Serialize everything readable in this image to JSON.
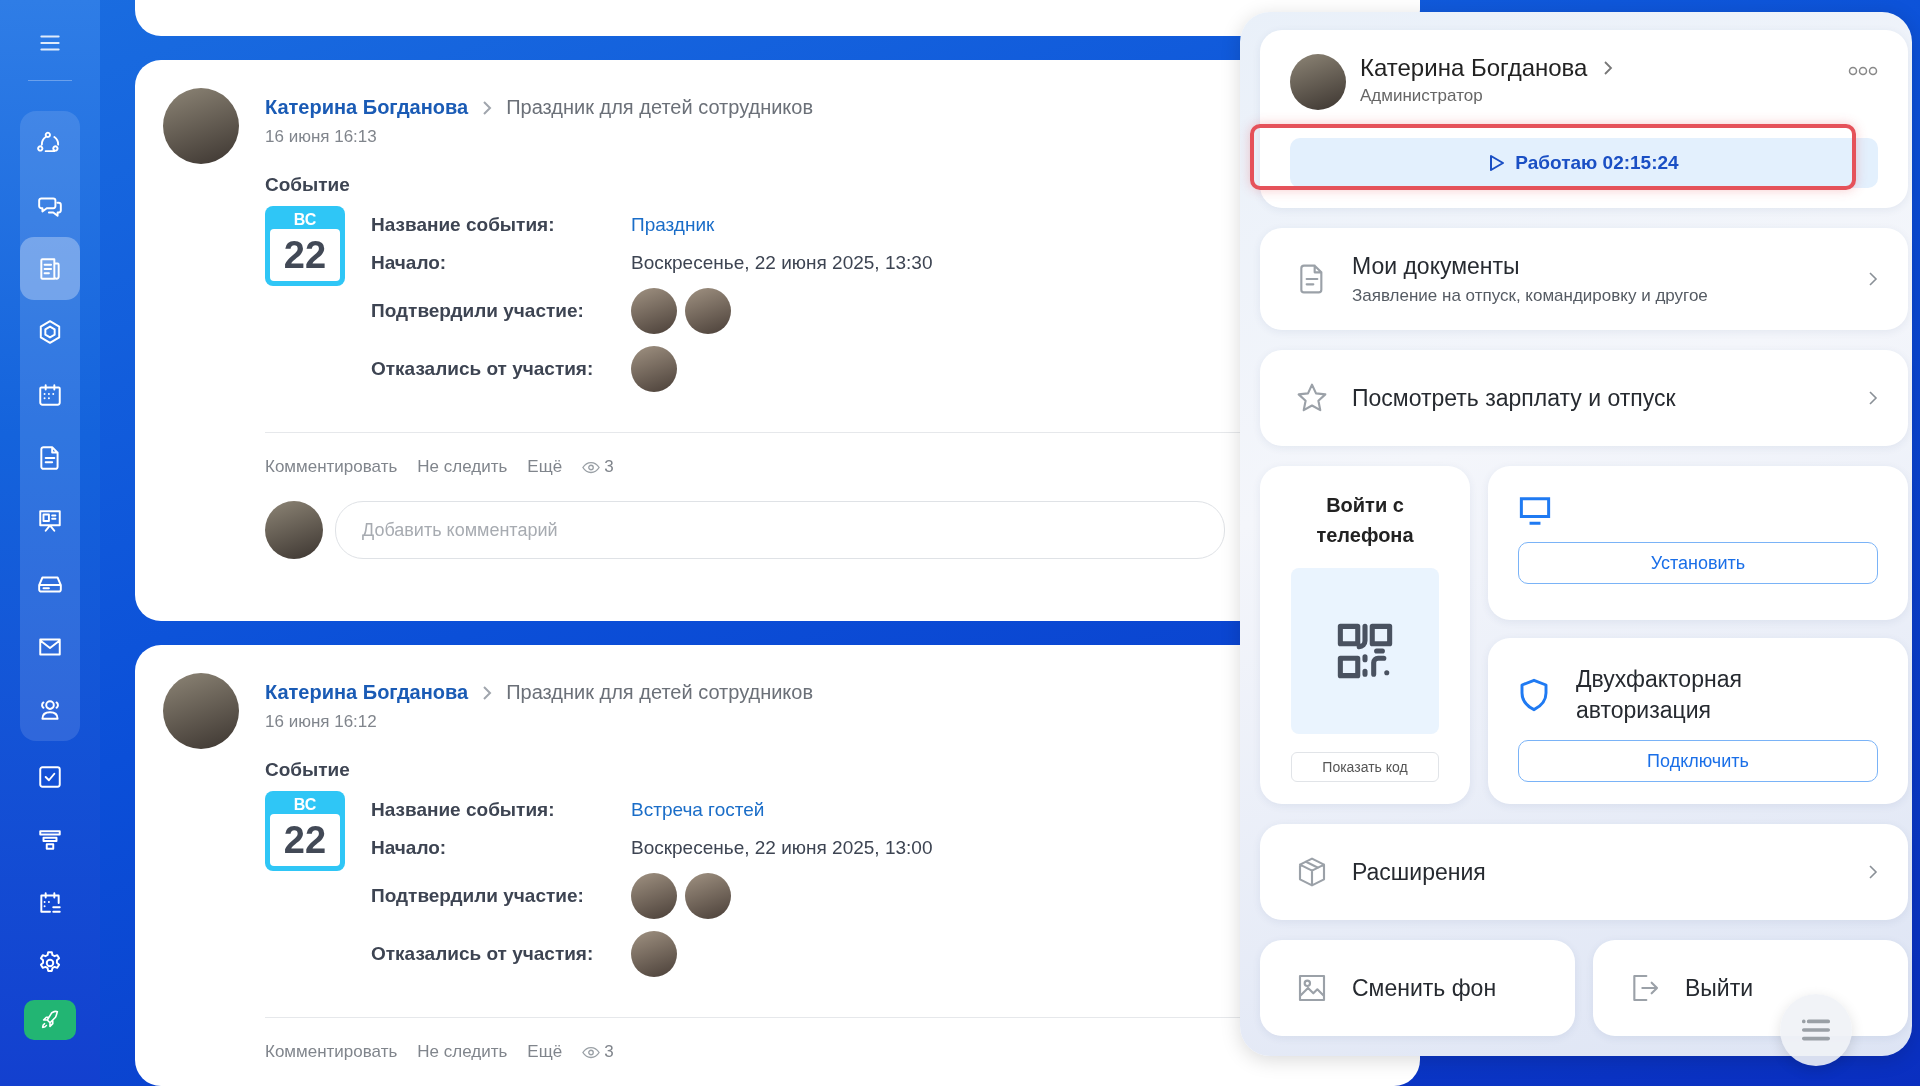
{
  "sidebar": {
    "group_items": [
      {
        "selected": false
      },
      {
        "selected": false
      },
      {
        "selected": true
      },
      {
        "selected": false
      },
      {
        "selected": false
      },
      {
        "selected": false
      },
      {
        "selected": false
      },
      {
        "selected": false
      },
      {
        "selected": false
      },
      {
        "selected": false
      }
    ],
    "extra_items": [
      {
        "selected": false
      },
      {
        "selected": false
      },
      {
        "selected": false
      }
    ]
  },
  "posts": [
    {
      "author": "Катерина Богданова",
      "target": "Праздник для детей сотрудников",
      "time": "16 июня 16:13",
      "section": "Событие",
      "weekday": "ВС",
      "day": "22",
      "fields": [
        {
          "kind": "link",
          "label": "Название события:",
          "value": "Праздник"
        },
        {
          "kind": "text",
          "label": "Начало:",
          "value": "Воскресенье, 22 июня 2025, 13:30"
        },
        {
          "kind": "people",
          "label": "Подтвердили участие:",
          "avatars": [
            {
              "kind": "photo"
            },
            {
              "kind": "photo"
            }
          ]
        },
        {
          "kind": "people",
          "label": "Отказались от участия:",
          "avatars": [
            {
              "kind": "photo"
            }
          ]
        }
      ],
      "actions": [
        "Комментировать",
        "Не следить",
        "Ещё"
      ],
      "views": "3",
      "comment_placeholder": "Добавить комментарий"
    },
    {
      "author": "Катерина Богданова",
      "target": "Праздник для детей сотрудников",
      "time": "16 июня 16:12",
      "section": "Событие",
      "weekday": "ВС",
      "day": "22",
      "fields": [
        {
          "kind": "link",
          "label": "Название события:",
          "value": "Встреча гостей"
        },
        {
          "kind": "text",
          "label": "Начало:",
          "value": "Воскресенье, 22 июня 2025, 13:00"
        },
        {
          "kind": "people",
          "label": "Подтвердили участие:",
          "avatars": [
            {
              "kind": "photo"
            },
            {
              "kind": "photo"
            }
          ]
        },
        {
          "kind": "people",
          "label": "Отказались от участия:",
          "avatars": [
            {
              "kind": "photo"
            }
          ]
        }
      ],
      "actions": [
        "Комментировать",
        "Не следить",
        "Ещё"
      ],
      "views": "3"
    }
  ],
  "panel": {
    "profile": {
      "name": "Катерина Богданова",
      "role": "Администратор",
      "work_button": {
        "label": "Работаю 02:15:24",
        "highlighted": true
      }
    },
    "documents": {
      "title": "Мои документы",
      "subtitle": "Заявление на отпуск, командировку и другое"
    },
    "salary": {
      "title": "Посмотреть зарплату и отпуск"
    },
    "phone_login": {
      "title": "Войти с телефона",
      "button": "Показать код"
    },
    "desktop_app": {
      "button": "Установить"
    },
    "two_factor": {
      "title": "Двухфакторная авторизация",
      "button": "Подключить"
    },
    "extensions": {
      "title": "Расширения"
    },
    "change_background": {
      "title": "Сменить фон"
    },
    "logout": {
      "title": "Выйти"
    }
  }
}
